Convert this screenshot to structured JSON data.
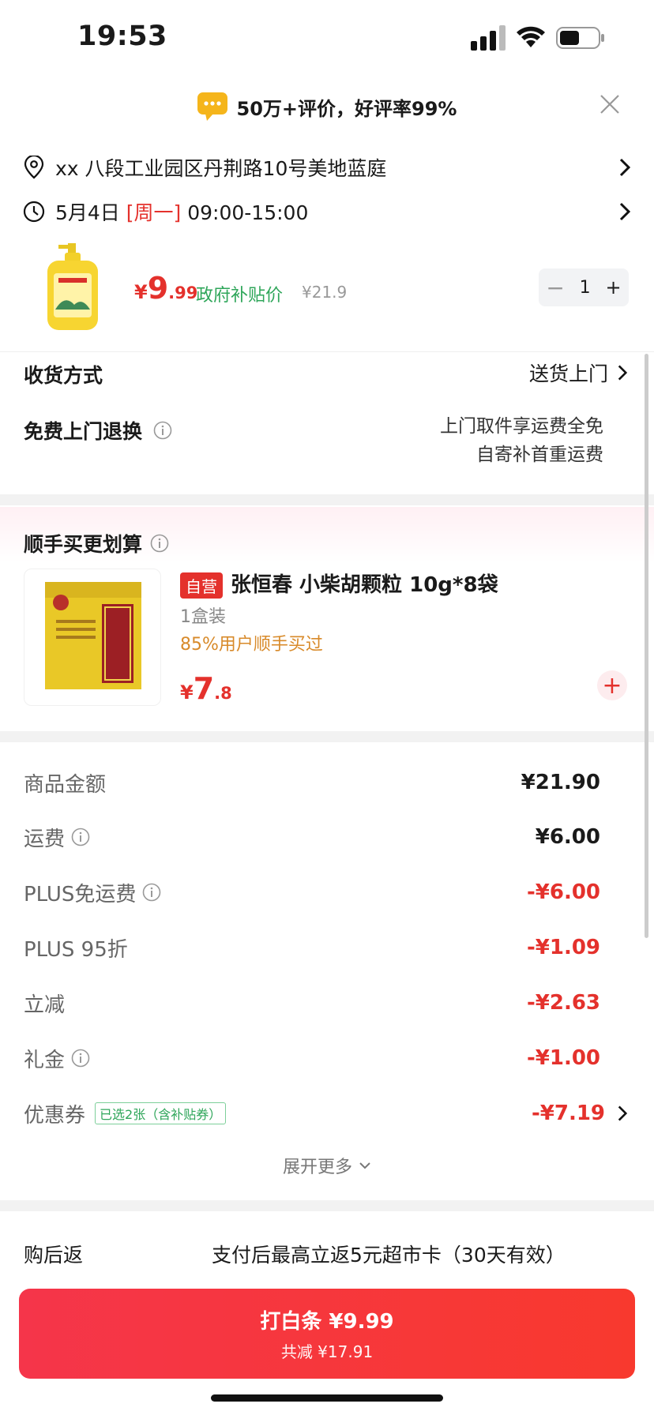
{
  "status_bar": {
    "time": "19:53"
  },
  "banner": {
    "text": "50万+评价，好评率99%"
  },
  "address": {
    "text": "xx  八段工业园区丹荆路10号美地蓝庭"
  },
  "delivery_time": {
    "date": "5月4日",
    "weekday": "[周一]",
    "slot": "09:00-15:00"
  },
  "product": {
    "price_symbol": "¥",
    "price_int": "9",
    "price_dec": ".99",
    "gov_label": "政府补贴价",
    "original_price": "¥21.9",
    "quantity": "1",
    "minus": "−",
    "plus": "+"
  },
  "shipping_method": {
    "label": "收货方式",
    "value": "送货上门"
  },
  "free_return": {
    "label": "免费上门退换",
    "line1": "上门取件享运费全免",
    "line2": "自寄补首重运费"
  },
  "addon": {
    "section_title": "顺手买更划算",
    "tag": "自营",
    "name": "张恒春 小柴胡颗粒 10g*8袋",
    "pack": "1盒装",
    "stat": "85%用户顺手买过",
    "price_symbol": "¥",
    "price_int": "7",
    "price_dec": ".8",
    "add": "+"
  },
  "summary": [
    {
      "label": "商品金额",
      "value": "¥21.90",
      "info": false
    },
    {
      "label": "运费",
      "value": "¥6.00",
      "info": true
    },
    {
      "label": "PLUS免运费",
      "value": "-¥6.00",
      "info": true
    },
    {
      "label": "PLUS 95折",
      "value": "-¥1.09",
      "info": false
    },
    {
      "label": "立减",
      "value": "-¥2.63",
      "info": false
    },
    {
      "label": "礼金",
      "value": "-¥1.00",
      "info": true
    },
    {
      "label": "优惠券",
      "value": "-¥7.19",
      "info": false,
      "tag": "已选2张（含补贴券）"
    }
  ],
  "expand": {
    "label": "展开更多"
  },
  "cashback": {
    "label": "购后返",
    "text": "支付后最高立返5元超市卡（30天有效）"
  },
  "pay_button": {
    "main": "打白条 ¥9.99",
    "sub": "共减 ¥17.91"
  },
  "colors": {
    "accent": "#e4312c",
    "green": "#2fa65a",
    "button": "#f5354a"
  }
}
